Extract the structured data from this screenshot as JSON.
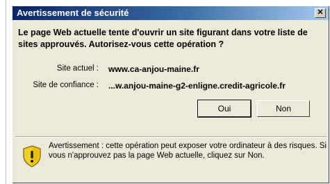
{
  "dialog": {
    "title": "Avertissement de sécurité",
    "close_glyph": "✕",
    "message": "Le page Web actuelle tente d'ouvrir un site figurant dans votre liste de sites approuvés. Autorisez-vous cette opération ?",
    "current_site_label": "Site actuel :",
    "current_site_value": "www.ca-anjou-maine.fr",
    "trusted_site_label": "Site de confiance :",
    "trusted_site_value": "...w.anjou-maine-g2-enligne.credit-agricole.fr",
    "buttons": {
      "yes": "Oui",
      "no": "Non"
    },
    "warning_text": "Avertissement : cette opération peut exposer votre ordinateur à des risques. Si vous n'approuvez pas la page Web actuelle, cliquez sur Non.",
    "warning_icon": "shield-warning-icon"
  },
  "colors": {
    "titlebar_start": "#0a246a",
    "titlebar_end": "#a6caf0",
    "dialog_bg": "#ece9d8",
    "shield_yellow": "#f5d020"
  }
}
